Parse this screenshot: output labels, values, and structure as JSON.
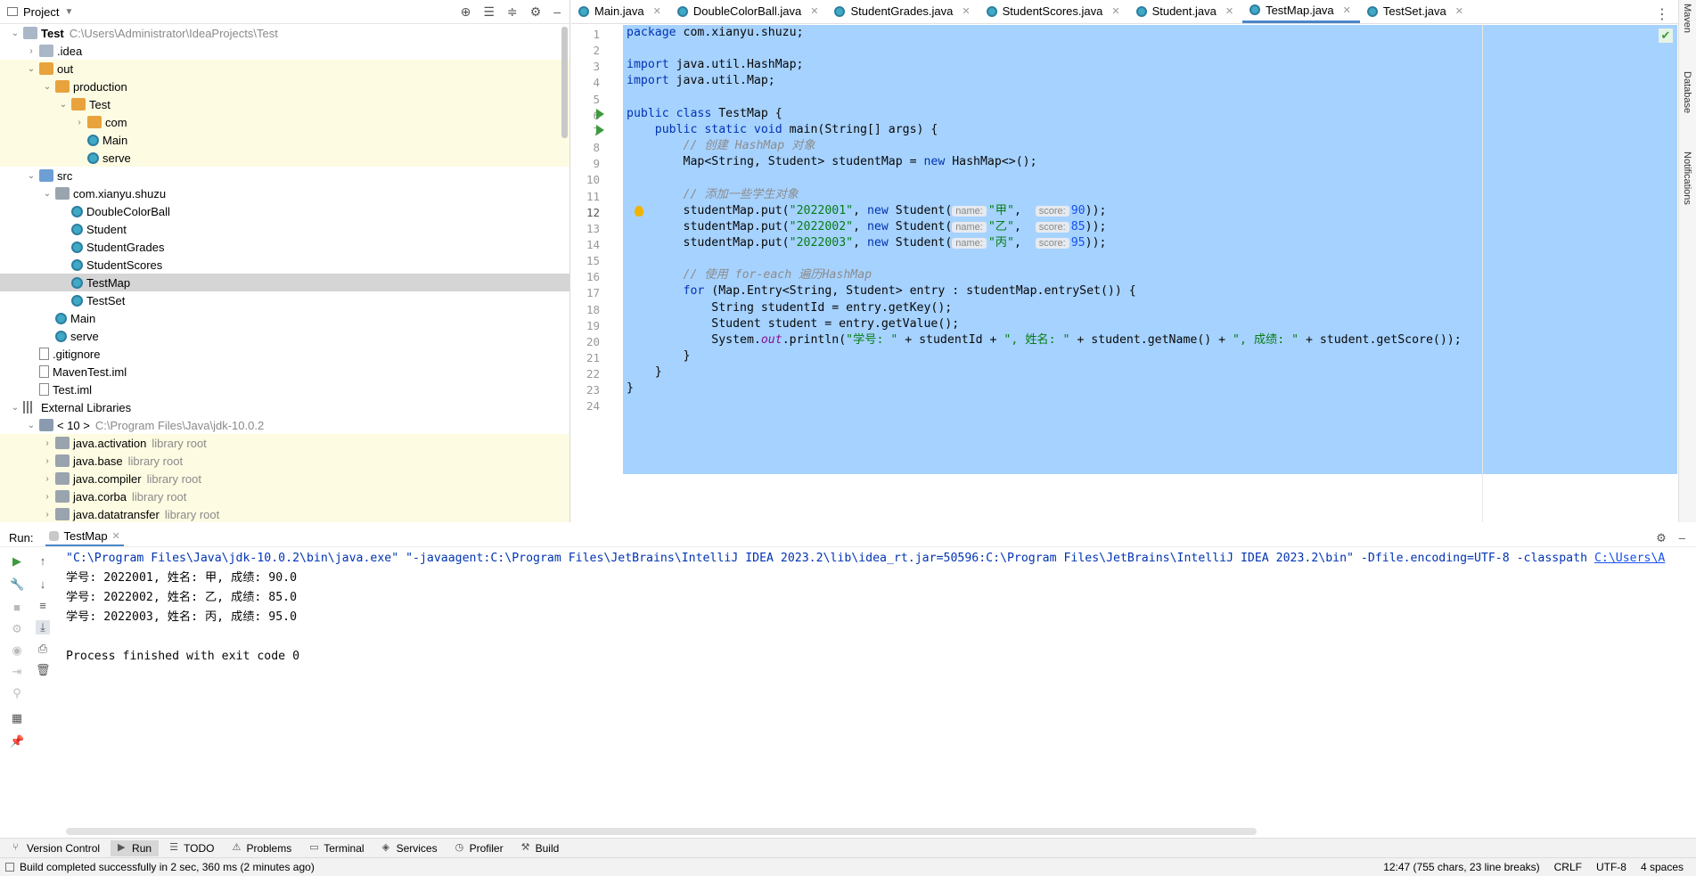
{
  "project": {
    "title": "Project",
    "tree": [
      {
        "label": "Test",
        "muted": "C:\\Users\\Administrator\\IdeaProjects\\Test",
        "bold": true,
        "indent": 0,
        "arrow": "down",
        "icon": "folder-icon",
        "y": false
      },
      {
        "label": ".idea",
        "indent": 1,
        "arrow": "right",
        "icon": "folder-icon"
      },
      {
        "label": "out",
        "indent": 1,
        "arrow": "down",
        "icon": "folder-orange-icon",
        "y": true
      },
      {
        "label": "production",
        "indent": 2,
        "arrow": "down",
        "icon": "folder-orange-icon",
        "y": true
      },
      {
        "label": "Test",
        "indent": 3,
        "arrow": "down",
        "icon": "folder-orange-icon",
        "y": true
      },
      {
        "label": "com",
        "indent": 4,
        "arrow": "right",
        "icon": "folder-orange-icon",
        "y": true
      },
      {
        "label": "Main",
        "indent": 4,
        "arrow": "",
        "icon": "class-icon",
        "y": true
      },
      {
        "label": "serve",
        "indent": 4,
        "arrow": "",
        "icon": "class-icon",
        "y": true
      },
      {
        "label": "src",
        "indent": 1,
        "arrow": "down",
        "icon": "folder-blue-icon"
      },
      {
        "label": "com.xianyu.shuzu",
        "indent": 2,
        "arrow": "down",
        "icon": "package-icon"
      },
      {
        "label": "DoubleColorBall",
        "indent": 3,
        "arrow": "",
        "icon": "class-icon"
      },
      {
        "label": "Student",
        "indent": 3,
        "arrow": "",
        "icon": "class-icon"
      },
      {
        "label": "StudentGrades",
        "indent": 3,
        "arrow": "",
        "icon": "class-icon"
      },
      {
        "label": "StudentScores",
        "indent": 3,
        "arrow": "",
        "icon": "class-icon"
      },
      {
        "label": "TestMap",
        "indent": 3,
        "arrow": "",
        "icon": "class-icon",
        "selected": true
      },
      {
        "label": "TestSet",
        "indent": 3,
        "arrow": "",
        "icon": "class-icon"
      },
      {
        "label": "Main",
        "indent": 2,
        "arrow": "",
        "icon": "class-icon"
      },
      {
        "label": "serve",
        "indent": 2,
        "arrow": "",
        "icon": "class-icon"
      },
      {
        "label": ".gitignore",
        "indent": 1,
        "arrow": "",
        "icon": "file-icon"
      },
      {
        "label": "MavenTest.iml",
        "indent": 1,
        "arrow": "",
        "icon": "file-icon"
      },
      {
        "label": "Test.iml",
        "indent": 1,
        "arrow": "",
        "icon": "file-icon"
      },
      {
        "label": "External Libraries",
        "indent": 0,
        "arrow": "down",
        "icon": "library-icon"
      },
      {
        "label": "< 10 >",
        "muted": "C:\\Program Files\\Java\\jdk-10.0.2",
        "indent": 1,
        "arrow": "down",
        "icon": "jdk-icon"
      },
      {
        "label": "java.activation",
        "muted": "library root",
        "indent": 2,
        "arrow": "right",
        "icon": "folder-gray-icon",
        "y": true
      },
      {
        "label": "java.base",
        "muted": "library root",
        "indent": 2,
        "arrow": "right",
        "icon": "folder-gray-icon",
        "y": true
      },
      {
        "label": "java.compiler",
        "muted": "library root",
        "indent": 2,
        "arrow": "right",
        "icon": "folder-gray-icon",
        "y": true
      },
      {
        "label": "java.corba",
        "muted": "library root",
        "indent": 2,
        "arrow": "right",
        "icon": "folder-gray-icon",
        "y": true
      },
      {
        "label": "java.datatransfer",
        "muted": "library root",
        "indent": 2,
        "arrow": "right",
        "icon": "folder-gray-icon",
        "y": true
      }
    ]
  },
  "tabs": [
    {
      "label": "Main.java",
      "active": false
    },
    {
      "label": "DoubleColorBall.java",
      "active": false
    },
    {
      "label": "StudentGrades.java",
      "active": false
    },
    {
      "label": "StudentScores.java",
      "active": false
    },
    {
      "label": "Student.java",
      "active": false
    },
    {
      "label": "TestMap.java",
      "active": true
    },
    {
      "label": "TestSet.java",
      "active": false
    }
  ],
  "editor": {
    "lines": [
      [
        [
          "kw",
          "package "
        ],
        [
          "",
          "com.xianyu.shuzu;"
        ]
      ],
      [],
      [
        [
          "kw",
          "import "
        ],
        [
          "",
          "java.util.HashMap;"
        ]
      ],
      [
        [
          "kw",
          "import "
        ],
        [
          "",
          "java.util.Map;"
        ]
      ],
      [],
      [
        [
          "kw",
          "public class "
        ],
        [
          "",
          "TestMap {"
        ]
      ],
      [
        [
          "",
          "    "
        ],
        [
          "kw",
          "public static void "
        ],
        [
          "",
          "main(String[] args) {"
        ]
      ],
      [
        [
          "",
          "        "
        ],
        [
          "cmt",
          "// 创建 HashMap 对象"
        ]
      ],
      [
        [
          "",
          "        Map<String, Student> studentMap = "
        ],
        [
          "kw",
          "new "
        ],
        [
          "",
          "HashMap<>();"
        ]
      ],
      [],
      [
        [
          "",
          "        "
        ],
        [
          "cmt",
          "// 添加一些学生对象"
        ]
      ],
      [
        [
          "",
          "        studentMap.put("
        ],
        [
          "str",
          "\"2022001\""
        ],
        [
          "",
          ", "
        ],
        [
          "kw",
          "new "
        ],
        [
          "",
          "Student("
        ],
        [
          "hint",
          "name:"
        ],
        [
          "str",
          "\"甲\""
        ],
        [
          "",
          ",  "
        ],
        [
          "hint",
          "score:"
        ],
        [
          "num",
          "90"
        ],
        [
          "",
          "));"
        ]
      ],
      [
        [
          "",
          "        studentMap.put("
        ],
        [
          "str",
          "\"2022002\""
        ],
        [
          "",
          ", "
        ],
        [
          "kw",
          "new "
        ],
        [
          "",
          "Student("
        ],
        [
          "hint",
          "name:"
        ],
        [
          "str",
          "\"乙\""
        ],
        [
          "",
          ",  "
        ],
        [
          "hint",
          "score:"
        ],
        [
          "num",
          "85"
        ],
        [
          "",
          "));"
        ]
      ],
      [
        [
          "",
          "        studentMap.put("
        ],
        [
          "str",
          "\"2022003\""
        ],
        [
          "",
          ", "
        ],
        [
          "kw",
          "new "
        ],
        [
          "",
          "Student("
        ],
        [
          "hint",
          "name:"
        ],
        [
          "str",
          "\"丙\""
        ],
        [
          "",
          ",  "
        ],
        [
          "hint",
          "score:"
        ],
        [
          "num",
          "95"
        ],
        [
          "",
          "));"
        ]
      ],
      [],
      [
        [
          "",
          "        "
        ],
        [
          "cmt",
          "// 使用 for-each 遍历HashMap"
        ]
      ],
      [
        [
          "",
          "        "
        ],
        [
          "kw",
          "for "
        ],
        [
          "",
          "(Map.Entry<String, Student> entry : studentMap.entrySet()) {"
        ]
      ],
      [
        [
          "",
          "            String studentId = entry.getKey();"
        ]
      ],
      [
        [
          "",
          "            Student student = entry.getValue();"
        ]
      ],
      [
        [
          "",
          "            System."
        ],
        [
          "fld",
          "out"
        ],
        [
          "",
          ".println("
        ],
        [
          "str",
          "\"学号: \""
        ],
        [
          "",
          " + studentId + "
        ],
        [
          "str",
          "\", 姓名: \""
        ],
        [
          "",
          " + student.getName() + "
        ],
        [
          "str",
          "\", 成绩: \""
        ],
        [
          "",
          " + student.getScore());"
        ]
      ],
      [
        [
          "",
          "        }"
        ]
      ],
      [
        [
          "",
          "    }"
        ]
      ],
      [
        [
          "",
          "}"
        ]
      ],
      []
    ],
    "line_numbers": [
      "1",
      "2",
      "3",
      "4",
      "5",
      "6",
      "7",
      "8",
      "9",
      "10",
      "11",
      "12",
      "13",
      "14",
      "15",
      "16",
      "17",
      "18",
      "19",
      "20",
      "21",
      "22",
      "23",
      "24"
    ]
  },
  "right_strip": [
    "Maven",
    "Database",
    "Notifications"
  ],
  "run": {
    "label": "Run:",
    "tab": "TestMap",
    "command": "\"C:\\Program Files\\Java\\jdk-10.0.2\\bin\\java.exe\" \"-javaagent:C:\\Program Files\\JetBrains\\IntelliJ IDEA 2023.2\\lib\\idea_rt.jar=50596:C:\\Program Files\\JetBrains\\IntelliJ IDEA 2023.2\\bin\" -Dfile.encoding=UTF-8 -classpath ",
    "command_link": "C:\\Users\\A",
    "output": [
      "学号: 2022001, 姓名: 甲, 成绩: 90.0",
      "学号: 2022002, 姓名: 乙, 成绩: 85.0",
      "学号: 2022003, 姓名: 丙, 成绩: 95.0",
      "",
      "Process finished with exit code 0"
    ]
  },
  "toolwindows": [
    {
      "label": "Version Control",
      "icon": "branch-icon",
      "active": false
    },
    {
      "label": "Run",
      "icon": "run-icon",
      "active": true
    },
    {
      "label": "TODO",
      "icon": "list-icon",
      "active": false
    },
    {
      "label": "Problems",
      "icon": "problems-icon",
      "active": false
    },
    {
      "label": "Terminal",
      "icon": "terminal-icon",
      "active": false
    },
    {
      "label": "Services",
      "icon": "services-icon",
      "active": false
    },
    {
      "label": "Profiler",
      "icon": "profiler-icon",
      "active": false
    },
    {
      "label": "Build",
      "icon": "build-icon",
      "active": false
    }
  ],
  "status": {
    "message": "Build completed successfully in 2 sec, 360 ms (2 minutes ago)",
    "position": "12:47 (755 chars, 23 line breaks)",
    "line_sep": "CRLF",
    "encoding": "UTF-8",
    "indent": "4 spaces"
  }
}
